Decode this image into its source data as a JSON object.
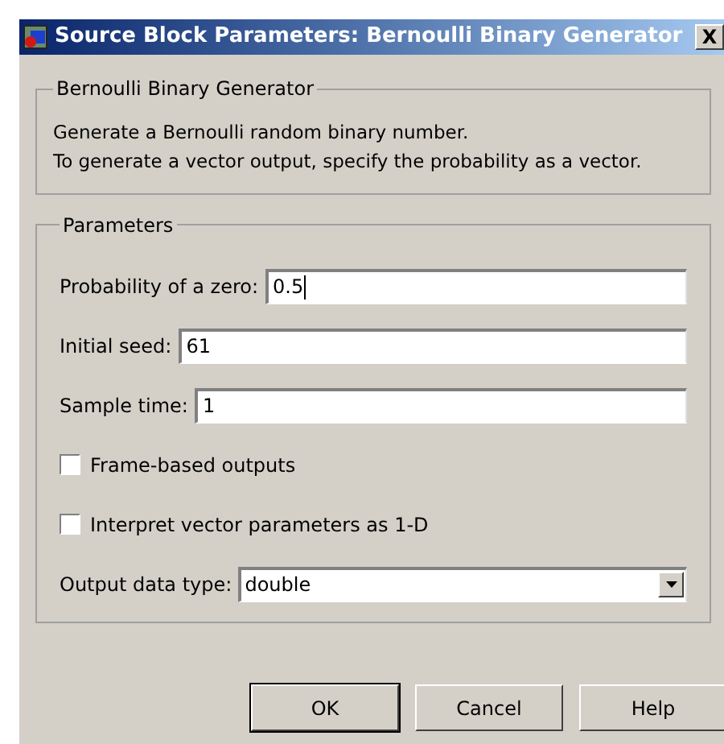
{
  "window": {
    "title": "Source Block Parameters: Bernoulli Binary Generator",
    "close": "X"
  },
  "description_group": {
    "title": "Bernoulli Binary Generator",
    "lines": [
      "Generate a Bernoulli random binary number.",
      "To generate a vector output, specify the probability as a vector."
    ]
  },
  "parameters": {
    "title": "Parameters",
    "fields": [
      {
        "kind": "text",
        "label": "Probability of a zero:",
        "value": "0.5",
        "focused": true
      },
      {
        "kind": "text",
        "label": "Initial seed:",
        "value": "61",
        "focused": false
      },
      {
        "kind": "text",
        "label": "Sample time:",
        "value": "1",
        "focused": false
      },
      {
        "kind": "checkbox",
        "label": "Frame-based outputs",
        "checked": false
      },
      {
        "kind": "checkbox",
        "label": "Interpret vector parameters as 1-D",
        "checked": false
      },
      {
        "kind": "dropdown",
        "label": "Output data type:",
        "value": "double"
      }
    ]
  },
  "buttons": [
    {
      "label": "OK",
      "default": true
    },
    {
      "label": "Cancel",
      "default": false
    },
    {
      "label": "Help",
      "default": false
    }
  ]
}
